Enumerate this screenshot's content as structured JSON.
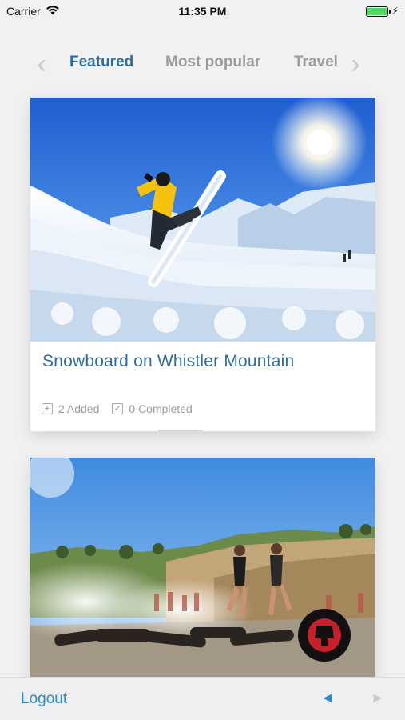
{
  "status_bar": {
    "carrier": "Carrier",
    "time": "11:35 PM"
  },
  "tabs": [
    {
      "label": "Featured",
      "active": true
    },
    {
      "label": "Most popular",
      "active": false
    },
    {
      "label": "Travel",
      "active": false
    }
  ],
  "cards": [
    {
      "title": "Snowboard on Whistler Mountain",
      "added": "2 Added",
      "completed": "0 Completed"
    },
    {
      "title": "",
      "badge": "Reebok SPARTAN RACE"
    }
  ],
  "toolbar": {
    "logout_label": "Logout",
    "back_symbol": "◄",
    "forward_symbol": "►"
  },
  "colors": {
    "accent": "#2d6da3",
    "link": "#2d8bd0",
    "muted": "#9b9c9e",
    "background": "#f1f1f2"
  }
}
